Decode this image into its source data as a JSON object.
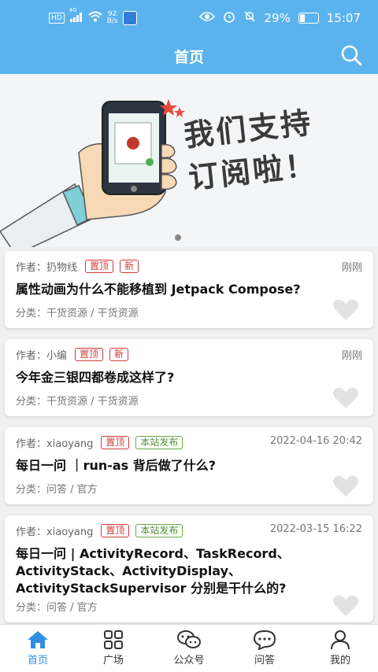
{
  "status_bar": {
    "network": "HD",
    "signal": "4G",
    "speed_value": "92",
    "speed_unit": "B/s",
    "battery": "29%",
    "time": "15:07"
  },
  "app_bar": {
    "title": "首页",
    "search_icon": "search-icon"
  },
  "banner": {
    "line1": "我们支持",
    "line2": "订阅啦！",
    "page_index": 1,
    "page_count": 1
  },
  "articles": [
    {
      "author_label": "作者：",
      "author": "扔物线",
      "tags": [
        {
          "text": "置顶",
          "color": "#d23b3b"
        },
        {
          "text": "新",
          "color": "#d23b3b"
        }
      ],
      "date": "刚刚",
      "title": "属性动画为什么不能移植到 Jetpack Compose?",
      "category": "分类：干货资源 / 干货资源"
    },
    {
      "author_label": "作者：",
      "author": "小编",
      "tags": [
        {
          "text": "置顶",
          "color": "#d23b3b"
        },
        {
          "text": "新",
          "color": "#d23b3b"
        }
      ],
      "date": "刚刚",
      "title": "今年金三银四都卷成这样了?",
      "category": "分类：干货资源 / 干货资源"
    },
    {
      "author_label": "作者：",
      "author": "xiaoyang",
      "tags": [
        {
          "text": "置顶",
          "color": "#d23b3b"
        },
        {
          "text": "本站发布",
          "color": "#4e8f2e"
        }
      ],
      "date": "2022-04-16 20:42",
      "title": "每日一问 ｜run-as 背后做了什么?",
      "category": "分类：问答 / 官方"
    },
    {
      "author_label": "作者：",
      "author": "xiaoyang",
      "tags": [
        {
          "text": "置顶",
          "color": "#d23b3b"
        },
        {
          "text": "本站发布",
          "color": "#4e8f2e"
        }
      ],
      "date": "2022-03-15 16:22",
      "title": "每日一问 | ActivityRecord、TaskRecord、ActivityStack、ActivityDisplay、ActivityStackSupervisor 分别是干什么的?",
      "category": "分类：问答 / 官方"
    }
  ],
  "bottom_nav": [
    {
      "label": "首页",
      "icon": "home-icon",
      "active": true
    },
    {
      "label": "广场",
      "icon": "grid-icon",
      "active": false
    },
    {
      "label": "公众号",
      "icon": "wechat-icon",
      "active": false
    },
    {
      "label": "问答",
      "icon": "chat-bubble-icon",
      "active": false
    },
    {
      "label": "我的",
      "icon": "user-icon",
      "active": false
    }
  ],
  "colors": {
    "primary": "#5bb3ee",
    "active_tab": "#2f8de4",
    "tag_red": "#d23b3b",
    "tag_green": "#4e8f2e"
  }
}
